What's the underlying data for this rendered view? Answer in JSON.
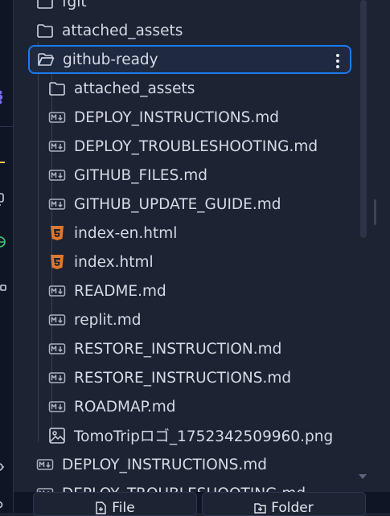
{
  "tree": {
    "top_items": [
      {
        "label": "fgit",
        "icon": "folder-icon"
      },
      {
        "label": "attached_assets",
        "icon": "folder-icon"
      }
    ],
    "selected_folder": {
      "label": "github-ready",
      "icon": "folder-open-icon"
    },
    "children": [
      {
        "label": "attached_assets",
        "icon": "folder-icon"
      },
      {
        "label": "DEPLOY_INSTRUCTIONS.md",
        "icon": "markdown-icon"
      },
      {
        "label": "DEPLOY_TROUBLESHOOTING.md",
        "icon": "markdown-icon"
      },
      {
        "label": "GITHUB_FILES.md",
        "icon": "markdown-icon"
      },
      {
        "label": "GITHUB_UPDATE_GUIDE.md",
        "icon": "markdown-icon"
      },
      {
        "label": "index-en.html",
        "icon": "html5-icon"
      },
      {
        "label": "index.html",
        "icon": "html5-icon"
      },
      {
        "label": "README.md",
        "icon": "markdown-icon"
      },
      {
        "label": "replit.md",
        "icon": "markdown-icon"
      },
      {
        "label": "RESTORE_INSTRUCTION.md",
        "icon": "markdown-icon"
      },
      {
        "label": "RESTORE_INSTRUCTIONS.md",
        "icon": "markdown-icon"
      },
      {
        "label": "ROADMAP.md",
        "icon": "markdown-icon"
      },
      {
        "label": "TomoTripロゴ_1752342509960.png",
        "icon": "image-icon"
      }
    ],
    "after_items": [
      {
        "label": "DEPLOY_INSTRUCTIONS.md",
        "icon": "markdown-icon"
      },
      {
        "label": "DEPLOY_TROUBLESHOOTING.md",
        "icon": "markdown-icon"
      }
    ]
  },
  "bottom_bar": {
    "file_label": "File",
    "folder_label": "Folder"
  },
  "colors": {
    "background": "#1c2333",
    "rail": "#0e1525",
    "selection_border": "#1a7cf0",
    "html_icon": "#e0772b",
    "text": "#d5dae4"
  }
}
